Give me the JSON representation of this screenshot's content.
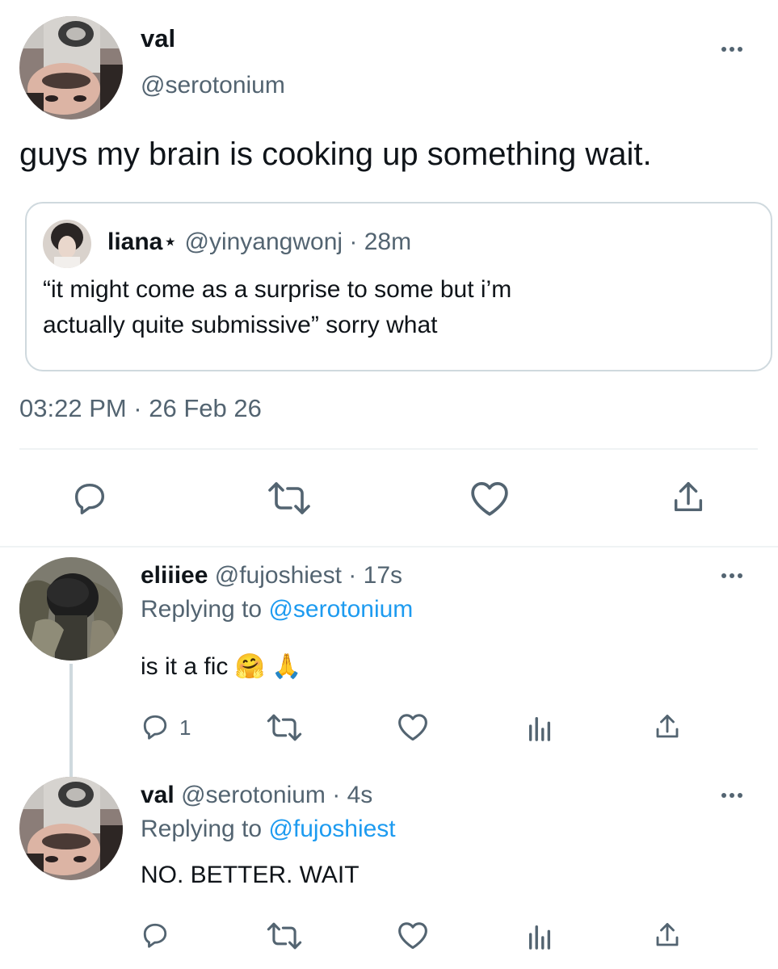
{
  "main_tweet": {
    "display_name": "val",
    "handle": "@serotonium",
    "text": "guys my brain is cooking up something wait.",
    "timestamp": "03:22 PM · 26 Feb 26",
    "more_icon": "more-horizontal-icon",
    "quoted": {
      "display_name": "liana",
      "name_symbol": "⋆",
      "handle": "@yinyangwonj",
      "sep": "·",
      "time": "28m",
      "text_line1": "“it might come as a surprise to some but i’m",
      "text_line2": "actually quite submissive” sorry what"
    },
    "actions": [
      "reply-icon",
      "retweet-icon",
      "like-icon",
      "share-icon"
    ]
  },
  "replies": [
    {
      "display_name": "eliiiee",
      "handle": "@fujoshiest",
      "sep": "·",
      "time": "17s",
      "replying_prefix": "Replying to ",
      "replying_to": "@serotonium",
      "text": "is it a fic 🤗 🙏",
      "reply_count": "1",
      "actions": [
        "reply-icon",
        "retweet-icon",
        "like-icon",
        "analytics-icon",
        "share-icon"
      ]
    },
    {
      "display_name": "val",
      "handle": "@serotonium",
      "sep": "·",
      "time": "4s",
      "replying_prefix": "Replying to ",
      "replying_to": "@fujoshiest",
      "text": "NO. BETTER. WAIT",
      "reply_count": "",
      "actions": [
        "reply-icon",
        "retweet-icon",
        "like-icon",
        "analytics-icon",
        "share-icon"
      ]
    }
  ],
  "colors": {
    "text": "#0f1419",
    "muted": "#536471",
    "link": "#1d9bf0",
    "border": "#cfd9de",
    "divider": "#eff3f4"
  }
}
